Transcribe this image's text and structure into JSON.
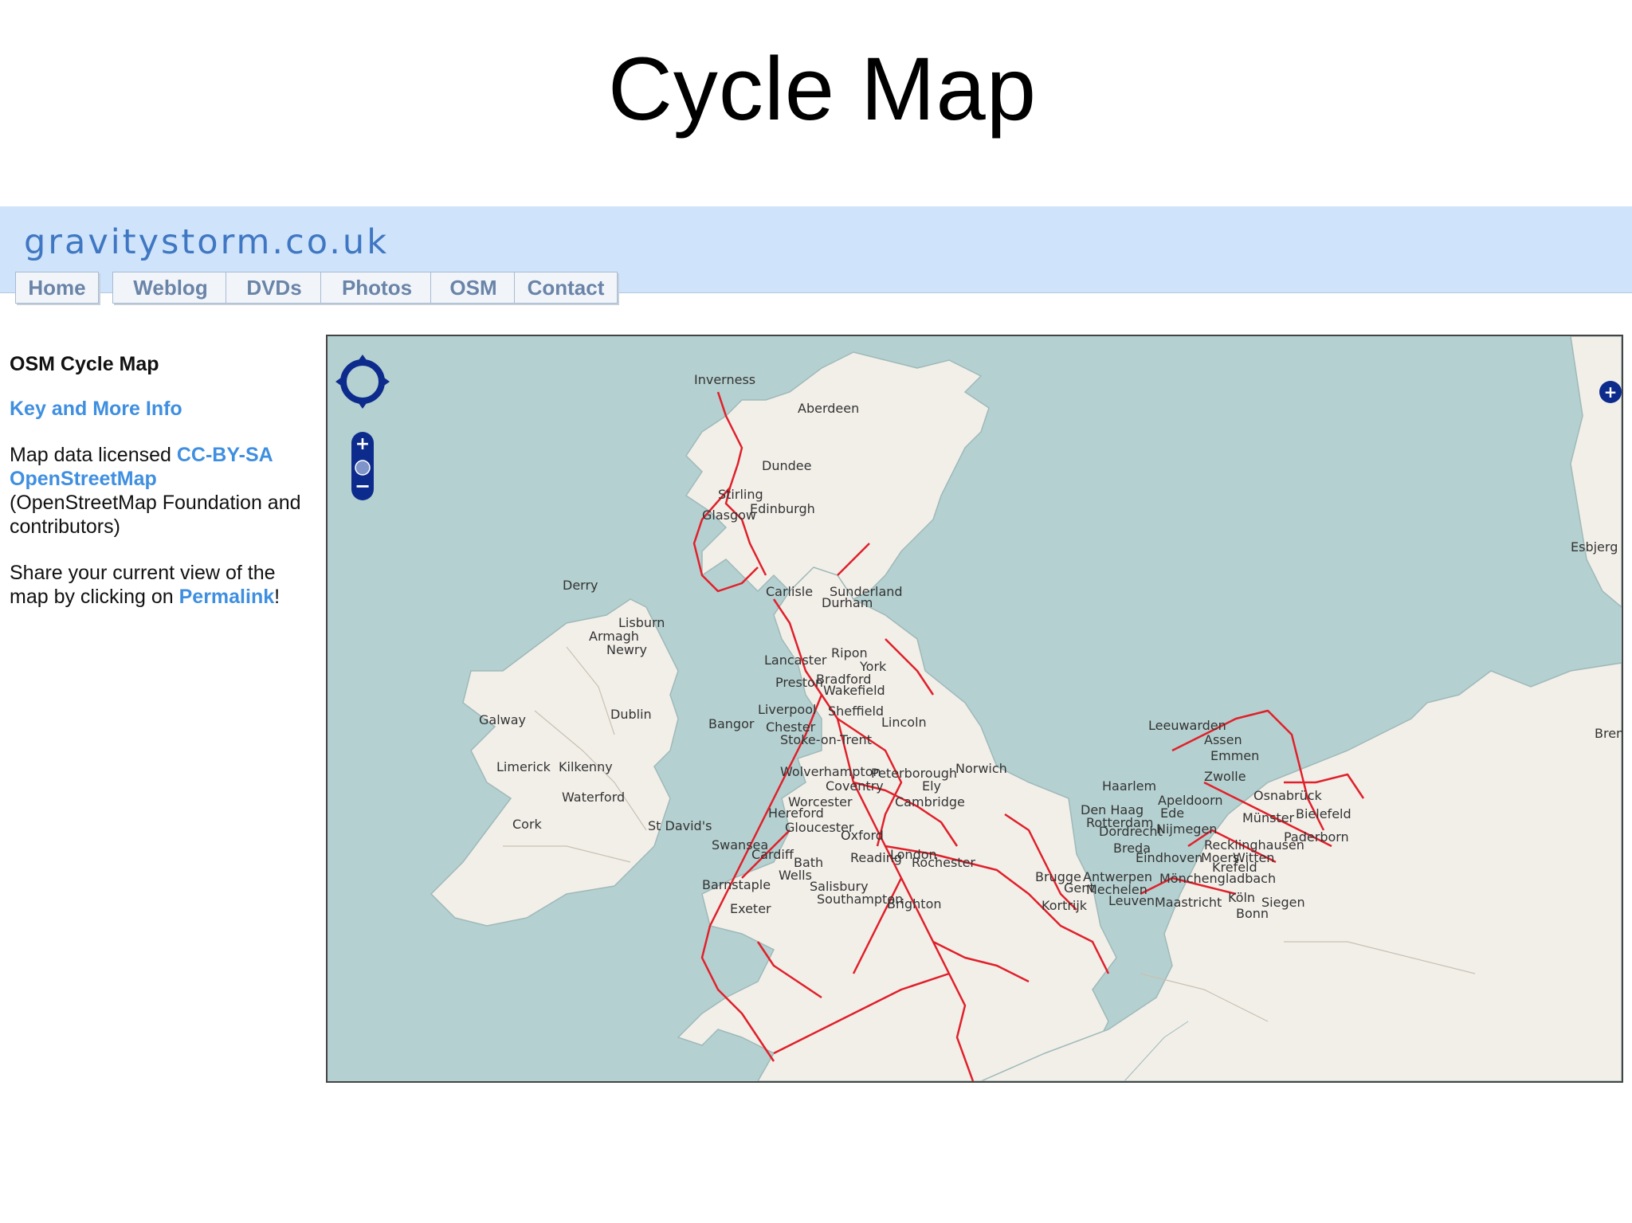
{
  "slide": {
    "title": "Cycle Map"
  },
  "site": {
    "name": "gravitystorm.co.uk",
    "nav": [
      "Home",
      "Weblog",
      "DVDs",
      "Photos",
      "OSM",
      "Contact"
    ]
  },
  "sidebar": {
    "heading": "OSM Cycle Map",
    "key_link": "Key and More Info",
    "license_prefix": "Map data licensed ",
    "license_link": "CC-BY-SA",
    "osm_link": "OpenStreetMap",
    "license_suffix": "(OpenStreetMap Foundation and contributors)",
    "share_text": "Share your current view of the map by clicking on ",
    "permalink": "Permalink",
    "share_end": "!"
  },
  "map": {
    "colors": {
      "sea": "#b5d0d0",
      "land": "#f2efe9",
      "route": "#e0202a",
      "control": "#0d2b8c"
    },
    "cities": [
      "Inverness",
      "Aberdeen",
      "Dundee",
      "Stirling",
      "Edinburgh",
      "Glasgow",
      "Derry",
      "Carlisle",
      "Sunderland",
      "Durham",
      "Lisburn",
      "Armagh",
      "Newry",
      "Lancaster",
      "Ripon",
      "York",
      "Preston",
      "Bradford",
      "Wakefield",
      "Galway",
      "Dublin",
      "Liverpool",
      "Sheffield",
      "Bangor",
      "Chester",
      "Lincoln",
      "Stoke-on-Trent",
      "Limerick",
      "Kilkenny",
      "Wolverhampton",
      "Peterborough",
      "Norwich",
      "Coventry",
      "Ely",
      "Waterford",
      "Worcester",
      "Cambridge",
      "Hereford",
      "Cork",
      "St David's",
      "Gloucester",
      "Oxford",
      "Swansea",
      "Cardiff",
      "Reading",
      "London",
      "Bath",
      "Rochester",
      "Wells",
      "Barnstaple",
      "Salisbury",
      "Southampton",
      "Brighton",
      "Exeter",
      "Esbjerg",
      "Leeuwarden",
      "Assen",
      "Bremen",
      "Emmen",
      "Zwolle",
      "Haarlem",
      "Osnabrück",
      "Apeldoorn",
      "Den Haag",
      "Ede",
      "Münster",
      "Bielefeld",
      "Rotterdam",
      "Dordrecht",
      "Nijmegen",
      "Paderborn",
      "Breda",
      "Recklinghausen",
      "Eindhoven",
      "Moers",
      "Witten",
      "Krefeld",
      "Brugge",
      "Antwerpen",
      "Mönchengladbach",
      "Gent",
      "Mechelen",
      "Kortrijk",
      "Leuven",
      "Maastricht",
      "Köln",
      "Siegen",
      "Bonn"
    ]
  }
}
